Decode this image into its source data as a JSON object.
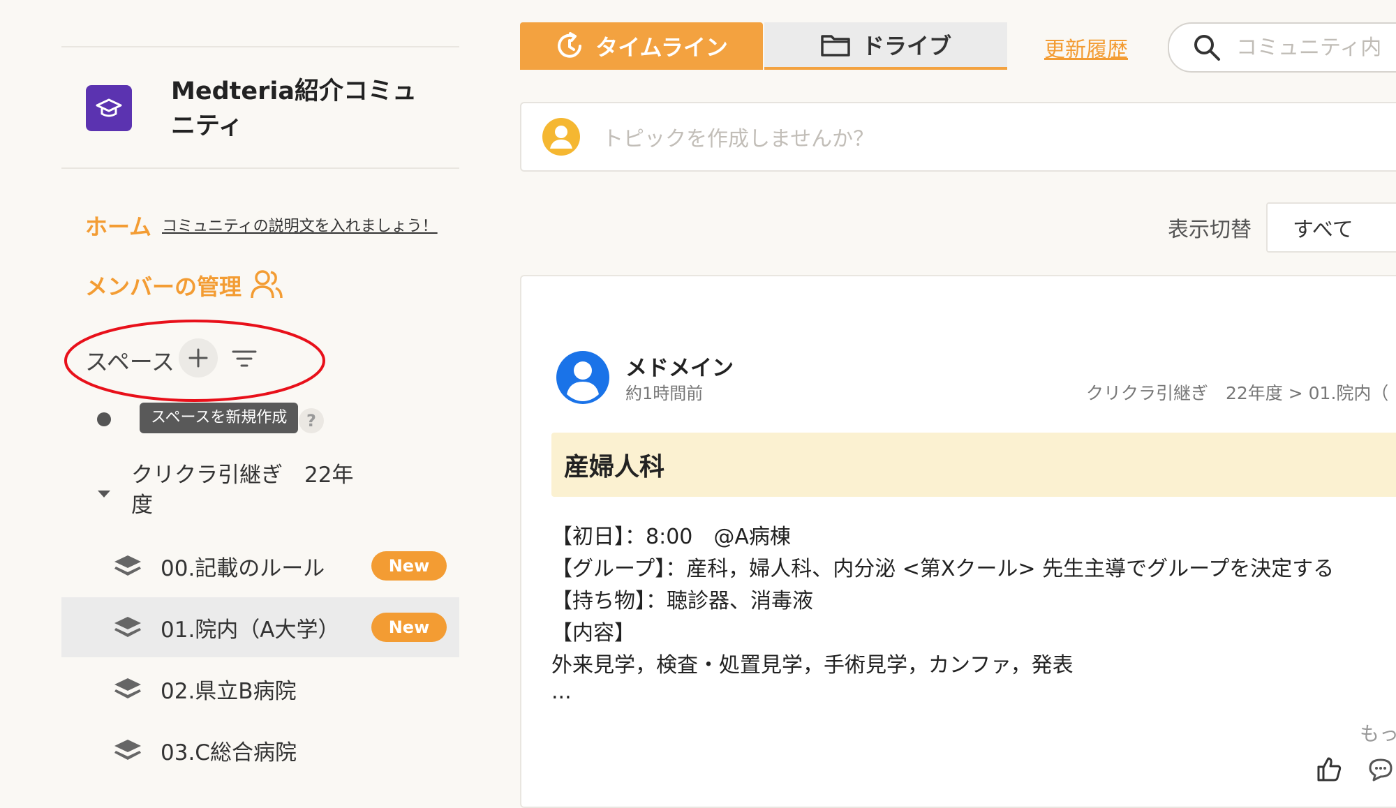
{
  "sidebar": {
    "community_name": "Medteria紹介コミュニティ",
    "home_label": "ホーム",
    "home_description": "コミュニティの説明文を入れましょう！",
    "member_management_label": "メンバーの管理",
    "spaces_label": "スペース",
    "tooltip_new_space": "スペースを新規作成",
    "help_badge": "?",
    "tree_label": "クリクラ引継ぎ　22年度",
    "space_items": [
      {
        "label": "00.記載のルール",
        "badge": "New"
      },
      {
        "label": "01.院内（A大学）",
        "badge": "New"
      },
      {
        "label": "02.県立B病院",
        "badge": ""
      },
      {
        "label": "03.C総合病院",
        "badge": ""
      }
    ]
  },
  "header": {
    "tab_timeline": "タイムライン",
    "tab_drive": "ドライブ",
    "history_link": "更新履歴",
    "search_placeholder": "コミュニティ内"
  },
  "composer": {
    "placeholder": "トピックを作成しませんか？"
  },
  "view_switch": {
    "label": "表示切替",
    "selected": "すべて"
  },
  "post": {
    "author": "メドメイン",
    "time": "約1時間前",
    "breadcrumb": "クリクラ引継ぎ　22年度 > 01.院内（",
    "title": "産婦人科",
    "body": [
      "【初日】：8:00　@A病棟",
      "【グループ】：産科，婦人科、内分泌 <第Xクール> 先生主導でグループを決定する",
      "【持ち物】：聴診器、消毒液",
      "【内容】",
      "外来見学，検査・処置見学，手術見学，カンファ，発表",
      "..."
    ],
    "more_link": "もっ"
  },
  "colors": {
    "accent": "#f39c33",
    "logo_bg": "#5b33b0",
    "annotation_red": "#e8101a",
    "avatar_blue": "#1a73e8"
  }
}
